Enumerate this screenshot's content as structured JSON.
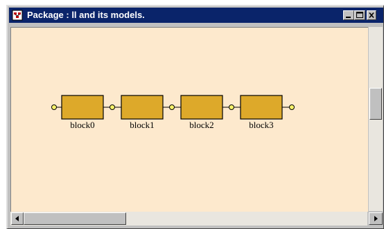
{
  "window": {
    "title": "Package : ll and its models."
  },
  "colors": {
    "title_bar": "#0a246a",
    "canvas_background": "#fde9cd",
    "block_fill": "#dda92a",
    "port_fill": "#f7f26a"
  },
  "icons": {
    "app": "package-icon",
    "minimize": "minimize-icon",
    "maximize": "maximize-icon",
    "close": "close-icon"
  },
  "blocks": [
    {
      "label": "block0"
    },
    {
      "label": "block1"
    },
    {
      "label": "block2"
    },
    {
      "label": "block3"
    }
  ]
}
